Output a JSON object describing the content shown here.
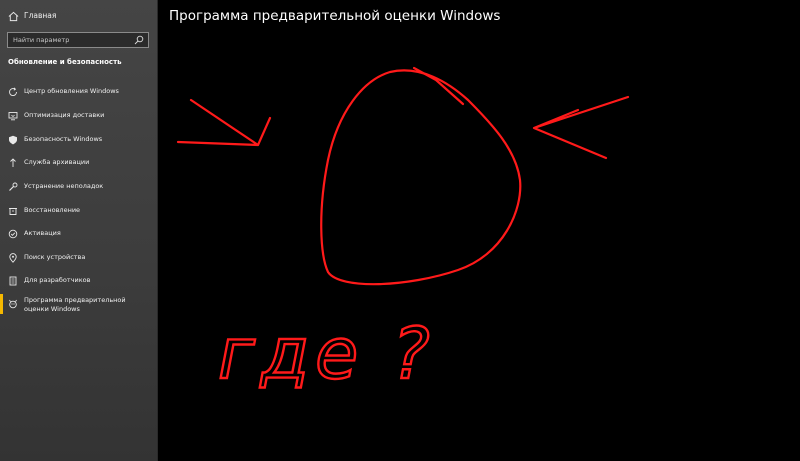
{
  "sidebar": {
    "home_label": "Главная",
    "search_placeholder": "Найти параметр",
    "section_title": "Обновление и безопасность",
    "items": [
      {
        "label": "Центр обновления Windows",
        "icon": "sync-icon"
      },
      {
        "label": "Оптимизация доставки",
        "icon": "delivery-optimization-icon"
      },
      {
        "label": "Безопасность Windows",
        "icon": "shield-icon"
      },
      {
        "label": "Служба архивации",
        "icon": "backup-arrow-icon"
      },
      {
        "label": "Устранение неполадок",
        "icon": "wrench-icon"
      },
      {
        "label": "Восстановление",
        "icon": "recovery-icon"
      },
      {
        "label": "Активация",
        "icon": "activation-check-icon"
      },
      {
        "label": "Поиск устройства",
        "icon": "find-device-icon"
      },
      {
        "label": "Для разработчиков",
        "icon": "developer-icon"
      },
      {
        "label": "Программа предварительной оценки Windows",
        "icon": "insider-icon",
        "active": true
      }
    ]
  },
  "main": {
    "title": "Программа предварительной оценки Windows",
    "annotation_text": "где ?"
  },
  "colors": {
    "accent": "#f5b800",
    "annotation": "#ff1a1a",
    "sidebar_bg": "#3d3d3d",
    "main_bg": "#000000"
  }
}
